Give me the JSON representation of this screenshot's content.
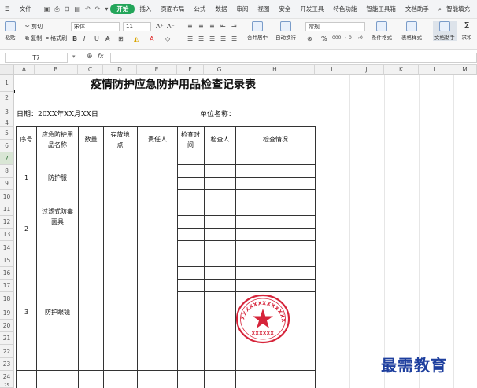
{
  "menubar": {
    "file": "文件",
    "tabs": [
      "开始",
      "插入",
      "页面布局",
      "公式",
      "数据",
      "审阅",
      "视图",
      "安全",
      "开发工具",
      "特色功能",
      "智能工具箱",
      "文档助手"
    ],
    "search": "智能填充"
  },
  "ribbon": {
    "paste": "粘贴",
    "cut": "剪切",
    "copy": "复制",
    "format_painter": "格式刷",
    "font_name": "宋体",
    "font_size": "11",
    "bold": "B",
    "italic": "I",
    "underline": "U",
    "grow_font": "A⁺",
    "shrink_font": "A⁻",
    "merge_center": "合并居中",
    "wrap_text": "自动换行",
    "number_format": "常规",
    "percent": "%",
    "thousands": "000",
    "conditional_format": "条件格式",
    "table_style": "表格样式",
    "doc_assistant": "文档助手",
    "sum": "求和"
  },
  "formula_bar": {
    "name_box": "T7",
    "fx": "fx"
  },
  "columns": [
    "A",
    "B",
    "C",
    "D",
    "E",
    "F",
    "G",
    "H",
    "I",
    "J",
    "K",
    "L",
    "M"
  ],
  "rows": [
    "1",
    "2",
    "3",
    "4",
    "5",
    "6",
    "7",
    "8",
    "9",
    "10",
    "11",
    "12",
    "13",
    "14",
    "15",
    "16",
    "17",
    "18",
    "19",
    "20",
    "21",
    "22",
    "23",
    "24",
    "25"
  ],
  "sheet": {
    "title": "疫情防护应急防护用品检查记录表",
    "date_label": "日期：20XX年XX月XX日",
    "unit_label": "单位名称：",
    "headers": {
      "seq": "序号",
      "item": "应急防护用品名称",
      "qty": "数量",
      "location": "存放地点",
      "owner": "责任人",
      "check_time": "检查时间",
      "inspector": "检查人",
      "status": "检查情况"
    },
    "items": [
      {
        "seq": "1",
        "name": "防护服"
      },
      {
        "seq": "2",
        "name": "过滤式防毒面具"
      },
      {
        "seq": "3",
        "name": "防护眼镜"
      }
    ]
  },
  "stamp": {
    "text": "XXXXXXXXXXXXXX",
    "bottom_text": "XXXXXX",
    "color": "#d6243a"
  },
  "watermark": "最需教育"
}
